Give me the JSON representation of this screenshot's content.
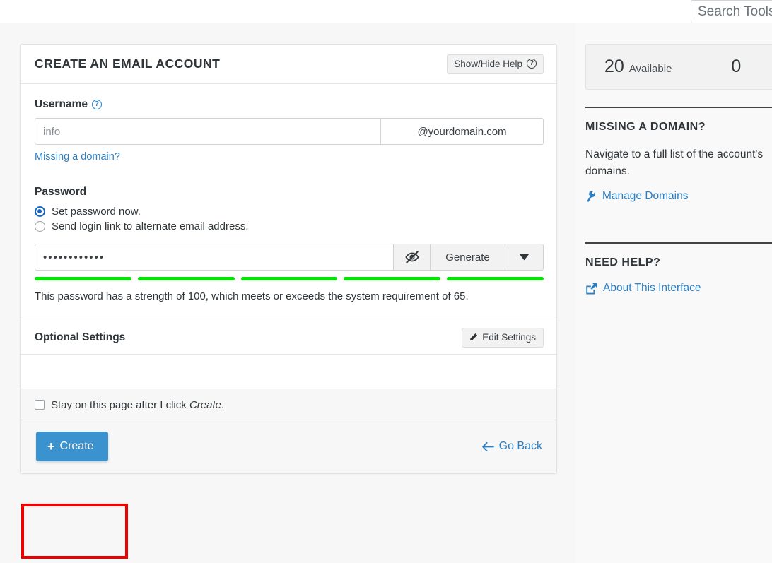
{
  "topbar": {
    "search_placeholder": "Search Tools",
    "search_value": ""
  },
  "card": {
    "title": "CREATE AN EMAIL ACCOUNT",
    "help_button": "Show/Hide Help",
    "help_icon": "question-circle-icon",
    "username": {
      "label": "Username",
      "tooltip_icon": "question-circle-icon",
      "placeholder": "info",
      "value": "",
      "domain_addon": "@yourdomain.com",
      "missing_domain_link": "Missing a domain?"
    },
    "password": {
      "label": "Password",
      "options": [
        {
          "label": "Set password now.",
          "selected": true
        },
        {
          "label": "Send login link to alternate email address.",
          "selected": false
        }
      ],
      "value": "••••••••••••",
      "eye_icon": "eye-slash-icon",
      "generate_label": "Generate",
      "caret_icon": "chevron-down-icon",
      "strength_segments": 5,
      "strength_filled": 5,
      "strength_color": "#00e800",
      "strength_text": "This password has a strength of 100, which meets or exceeds the system requirement of 65.",
      "strength_value": 100,
      "strength_requirement": 65
    },
    "optional": {
      "title": "Optional Settings",
      "edit_button": "Edit Settings",
      "edit_icon": "pencil-icon"
    },
    "footer": {
      "stay_checkbox_pre": "Stay on this page after I click ",
      "stay_checkbox_em": "Create",
      "stay_checkbox_post": ".",
      "stay_checked": false,
      "create_button": "Create",
      "create_icon": "plus-icon",
      "create_color": "#3a92cf",
      "go_back": "Go Back",
      "go_back_icon": "arrow-left-icon"
    }
  },
  "sidebar": {
    "stats": [
      {
        "number": "20",
        "label": "Available"
      },
      {
        "number": "0",
        "label": ""
      }
    ],
    "sections": [
      {
        "title": "MISSING A DOMAIN?",
        "text": "Navigate to a full list of the account's domains.",
        "link": "Manage Domains",
        "link_icon": "wrench-icon"
      },
      {
        "title": "NEED HELP?",
        "text": "",
        "link": "About This Interface",
        "link_icon": "external-link-icon"
      }
    ]
  },
  "highlight": {
    "color": "#f00000",
    "target": "create-button"
  }
}
